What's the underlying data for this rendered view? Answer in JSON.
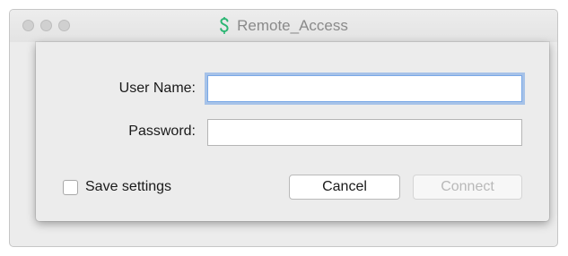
{
  "window": {
    "title": "Remote_Access",
    "app_icon": "dollar-s-icon",
    "accent_color": "#2bb673"
  },
  "form": {
    "username_label": "User Name:",
    "username_value": "",
    "password_label": "Password:",
    "password_value": ""
  },
  "options": {
    "save_settings_label": "Save settings",
    "save_settings_checked": false
  },
  "buttons": {
    "cancel_label": "Cancel",
    "connect_label": "Connect",
    "connect_enabled": false
  }
}
